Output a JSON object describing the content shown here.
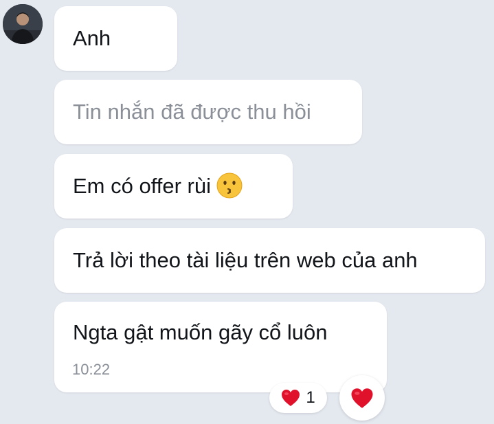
{
  "messages": [
    {
      "text": "Anh",
      "recalled": false
    },
    {
      "text": "Tin nhắn đã được thu hồi",
      "recalled": true
    },
    {
      "text": "Em có offer rùi",
      "emoji": "kissing-face-emoji",
      "recalled": false
    },
    {
      "text": "Trả lời theo tài liệu trên web của anh",
      "recalled": false
    },
    {
      "text": "Ngta gật muốn gãy cổ luôn",
      "time": "10:22",
      "recalled": false
    }
  ],
  "reaction": {
    "icon": "heart-icon",
    "count": "1",
    "color": "#e0112b"
  },
  "react_button": {
    "icon": "heart-icon"
  },
  "colors": {
    "background": "#e4e8ef",
    "bubble": "#ffffff",
    "text": "#111418",
    "muted": "#8a8f98"
  }
}
